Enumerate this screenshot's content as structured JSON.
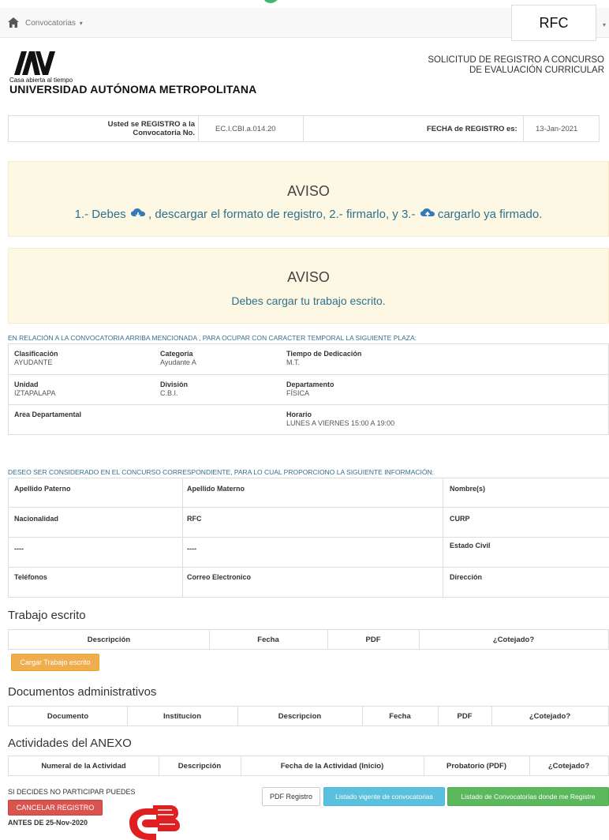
{
  "nav": {
    "menu_label": "Convocatorias",
    "menu_caret": "▾",
    "rfc_box": "RFC",
    "rfc_caret": "▾"
  },
  "header": {
    "slogan": "Casa abierta al tiempo",
    "university": "UNIVERSIDAD AUTÓNOMA METROPOLITANA",
    "title_line1": "SOLICITUD DE REGISTRO A CONCURSO",
    "title_line2": "DE EVALUACIÓN CURRICULAR"
  },
  "registration": {
    "label_line1": "Usted se REGISTRO a la",
    "label_line2": "Convocatoria No.",
    "convocatoria": "EC.I.CBI.a.014.20",
    "date_label": "FECHA de REGISTRO es:",
    "date_value": "13-Jan-2021"
  },
  "alert1": {
    "title": "AVISO",
    "text_a": "1.- Debes",
    "text_b": ", descargar el formato de registro, 2.- firmarlo, y 3.-",
    "text_c": "cargarlo ya firmado."
  },
  "alert2": {
    "title": "AVISO",
    "text": "Debes cargar tu trabajo escrito."
  },
  "plaza": {
    "caption": "EN RELACIÓN A LA CONVOCATORIA ARRIBA MENCIONADA , PARA OCUPAR CON CARACTER TEMPORAL LA SIGUIENTE PLAZA:",
    "clasificacion_label": "Clasificación",
    "clasificacion_value": "AYUDANTE",
    "categoria_label": "Categoria",
    "categoria_value": "Ayudante A",
    "tiempo_label": "Tiempo de Dedicación",
    "tiempo_value": "M.T.",
    "unidad_label": "Unidad",
    "unidad_value": "IZTAPALAPA",
    "division_label": "División",
    "division_value": "C.B.I.",
    "departamento_label": "Departamento",
    "departamento_value": "FÍSICA",
    "area_label": "Area Departamental",
    "horario_label": "Horario",
    "horario_value": "LUNES A VIERNES 15:00 A 19:00"
  },
  "personal": {
    "caption": "DESEO SER CONSIDERADO EN EL CONCURSO CORRESPONDIENTE, PARA LO CUAL PROPORCIONO LA SIGUIENTE INFORMACIÓN:",
    "apellido_paterno": "Apellido Paterno",
    "apellido_materno": "Apellido Materno",
    "nombres": "Nombre(s)",
    "nacionalidad": "Nacionalidad",
    "rfc": "RFC",
    "curp": "CURP",
    "row3_col1": "----",
    "row3_col2": "----",
    "estado_civil": "Estado Civil",
    "telefonos": "Teléfonos",
    "correo": "Correo Electronico",
    "direccion": "Dirección"
  },
  "trabajo": {
    "title": "Trabajo escrito",
    "headers": [
      "Descripción",
      "Fecha",
      "PDF",
      "¿Cotejado?"
    ],
    "upload_button": "Cargar Trabajo escrito"
  },
  "documentos": {
    "title": "Documentos administrativos",
    "headers": [
      "Documento",
      "Institucion",
      "Descripcion",
      "Fecha",
      "PDF",
      "¿Cotejado?"
    ]
  },
  "actividades": {
    "title": "Actividades del ANEXO",
    "headers": [
      "Numeral de la Actividad",
      "Descripción",
      "Fecha de la Actividad (Inicio)",
      "Probatorio (PDF)",
      "¿Cotejado?"
    ]
  },
  "footer": {
    "note": "SI DECIDES NO PARTICIPAR PUEDES",
    "cancel_button": "CANCELAR REGISTRO",
    "deadline": "ANTES DE 25-Nov-2020",
    "pdf_button": "PDF Registro",
    "listado_button": "Listado vigente de convocatorias",
    "registradas_button": "Listado de Convocatorias donde me Registre"
  },
  "colors": {
    "alert_bg": "#fcf8e3",
    "info_text": "#31708f",
    "warning": "#f0ad4e",
    "danger": "#d9534f",
    "info": "#5bc0de",
    "success": "#5cb85c"
  }
}
